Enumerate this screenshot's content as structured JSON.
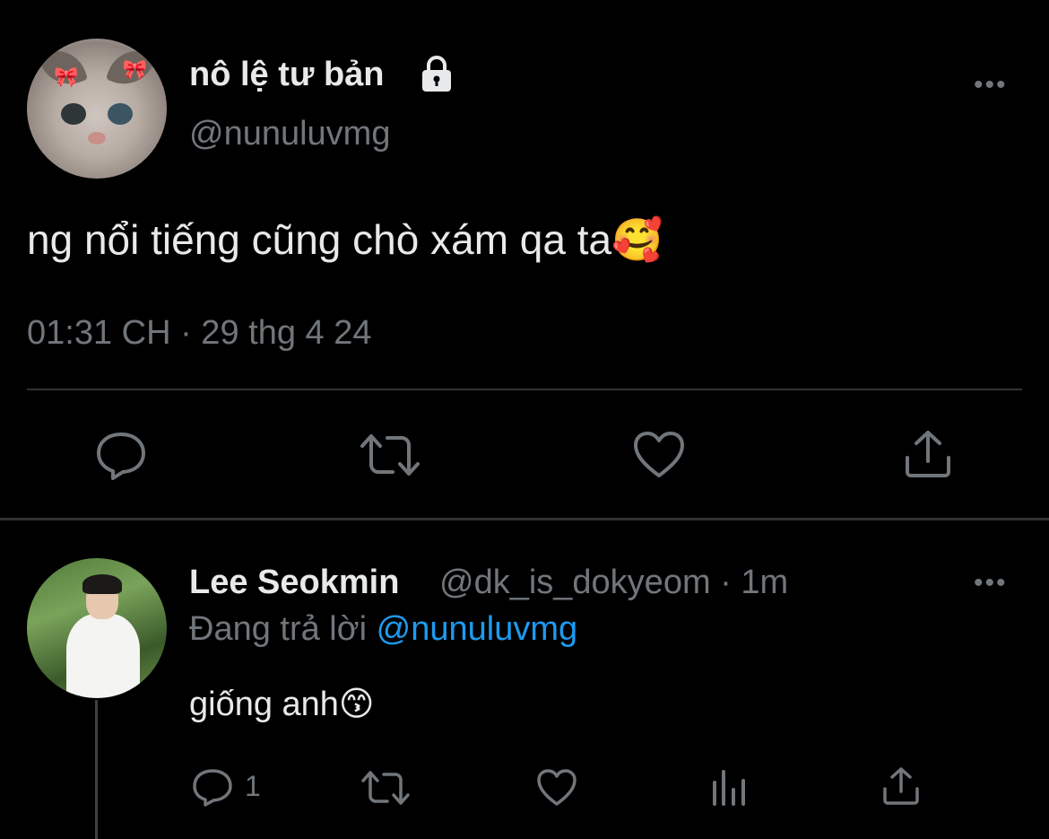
{
  "main_tweet": {
    "display_name": "nô lệ tư bản",
    "handle": "@nunuluvmg",
    "text": "ng nổi tiếng cũng chò xám qa ta🥰",
    "timestamp": "01:31 CH · 29 thg 4 24",
    "more_label": "•••",
    "avatar_icon": "cat-avatar",
    "actions": [
      "reply-icon",
      "retweet-icon",
      "like-icon",
      "share-icon"
    ]
  },
  "reply": {
    "display_name": "Lee Seokmin",
    "meta": "@dk_is_dokyeom · 1m",
    "replying_prefix": "Đang trả lời",
    "replying_mention": "@nunuluvmg",
    "text": "giống anh😙",
    "more_label": "•••",
    "reply_count": "1",
    "actions": [
      "reply-icon",
      "retweet-icon",
      "like-icon",
      "analytics-icon",
      "share-icon"
    ]
  },
  "colors": {
    "background": "#000000",
    "primary_text": "#e7e9ea",
    "secondary_text": "#71767b",
    "link": "#1d9bf0",
    "divider": "#2f3336"
  }
}
